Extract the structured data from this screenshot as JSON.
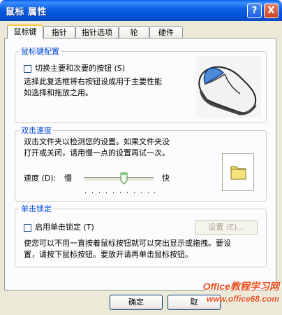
{
  "window": {
    "title": "鼠标 属性",
    "help_label": "?",
    "close_label": "X"
  },
  "tabs": [
    {
      "label": "鼠标键"
    },
    {
      "label": "指针"
    },
    {
      "label": "指针选项"
    },
    {
      "label": "轮"
    },
    {
      "label": "硬件"
    }
  ],
  "button_config": {
    "legend": "鼠标键配置",
    "swap_label": "切换主要和次要的按钮 (S)",
    "swap_checked": false,
    "description": "选择此复选框将右按钮设成用于主要性能\n如选择和拖放之用。"
  },
  "double_click": {
    "legend": "双击速度",
    "description": "双击文件夹以检测您的设置。如果文件夹没\n打开或关闭，请用慢一点的设置再试一次。",
    "speed_label": "速度 (D):",
    "slow_label": "慢",
    "fast_label": "快",
    "speed_value": 0.57
  },
  "click_lock": {
    "legend": "单击锁定",
    "enable_label": "启用单击锁定 (T)",
    "enable_checked": false,
    "settings_label": "设置 (E)...",
    "description": "使您可以不用一直按着鼠标按钮就可以突出显示或拖拽。要设\n置，请按下鼠标按钮。要放开请再单击鼠标按钮。"
  },
  "footer": {
    "ok_label": "确定",
    "cancel_label": "取"
  },
  "watermark": {
    "brand": "Office教程学习网",
    "url": "www.office68.com"
  },
  "colors": {
    "title_bar": "#0a5fe0",
    "group_label": "#0046d5",
    "tab_highlight": "#ffc83c",
    "watermark": "#e8501e"
  }
}
